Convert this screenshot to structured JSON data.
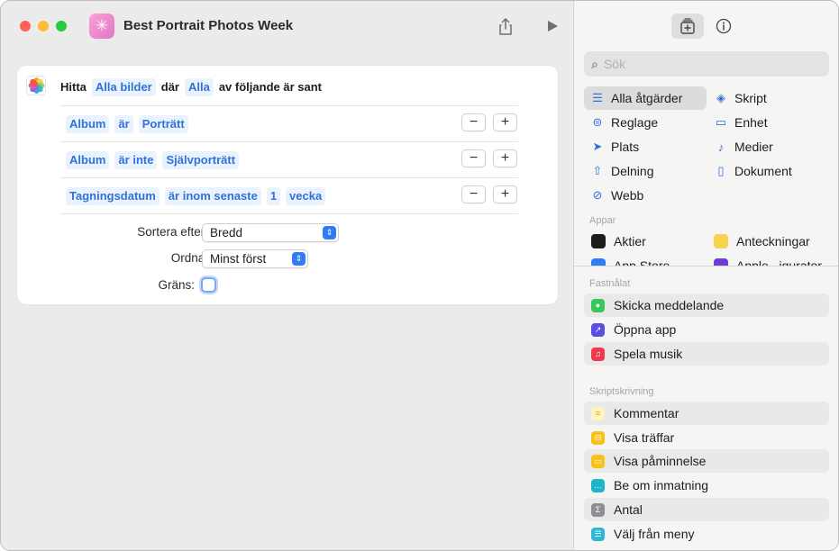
{
  "window": {
    "title": "Best Portrait Photos Week",
    "share_icon": "share-icon",
    "run_icon": "play-icon"
  },
  "find_action": {
    "find_label": "Hitta",
    "source": "Alla bilder",
    "where_label": "där",
    "match_mode": "Alla",
    "condition_suffix": "av följande är sant",
    "filters": [
      {
        "field": "Album",
        "operator": "är",
        "value": "Porträtt"
      },
      {
        "field": "Album",
        "operator": "är inte",
        "value": "Självporträtt"
      },
      {
        "field": "Tagningsdatum",
        "operator": "är inom senaste",
        "amount": "1",
        "unit": "vecka"
      }
    ],
    "remove_symbol": "−",
    "add_symbol": "+",
    "sort_label": "Sortera efter:",
    "sort_value": "Bredd",
    "order_label": "Ordna:",
    "order_value": "Minst först",
    "limit_label": "Gräns:"
  },
  "sidebar": {
    "search_placeholder": "Sök",
    "categories": [
      {
        "label": "Alla åtgärder",
        "icon": "list-icon",
        "selected": true
      },
      {
        "label": "Skript",
        "icon": "script-icon"
      },
      {
        "label": "Reglage",
        "icon": "toggles-icon"
      },
      {
        "label": "Enhet",
        "icon": "display-icon"
      },
      {
        "label": "Plats",
        "icon": "location-icon"
      },
      {
        "label": "Medier",
        "icon": "music-note-icon"
      },
      {
        "label": "Delning",
        "icon": "share-icon"
      },
      {
        "label": "Dokument",
        "icon": "document-icon"
      },
      {
        "label": "Webb",
        "icon": "compass-icon"
      }
    ],
    "apps_header": "Appar",
    "apps": [
      {
        "label": "Aktier",
        "color": "#1c1c1e"
      },
      {
        "label": "Anteckningar",
        "color": "#f5d34f"
      },
      {
        "label": "App Store",
        "color": "#2f7cf6"
      },
      {
        "label": "Apple...igurator",
        "color": "#6d3fd6"
      }
    ],
    "pinned_header": "Fastnålat",
    "pinned": [
      {
        "label": "Skicka meddelande",
        "color": "#34c759"
      },
      {
        "label": "Öppna app",
        "color": "#5b4de0"
      },
      {
        "label": "Spela musik",
        "color": "#f0384f"
      }
    ],
    "scripting_header": "Skriptskrivning",
    "scripting": [
      {
        "label": "Kommentar",
        "color": "#f5d34f"
      },
      {
        "label": "Visa träffar",
        "color": "#f6c21a"
      },
      {
        "label": "Visa påminnelse",
        "color": "#f6c21a"
      },
      {
        "label": "Be om inmatning",
        "color": "#1fb5c9"
      },
      {
        "label": "Antal",
        "color": "#8e8e93"
      },
      {
        "label": "Välj från meny",
        "color": "#2fb8d6"
      }
    ]
  }
}
